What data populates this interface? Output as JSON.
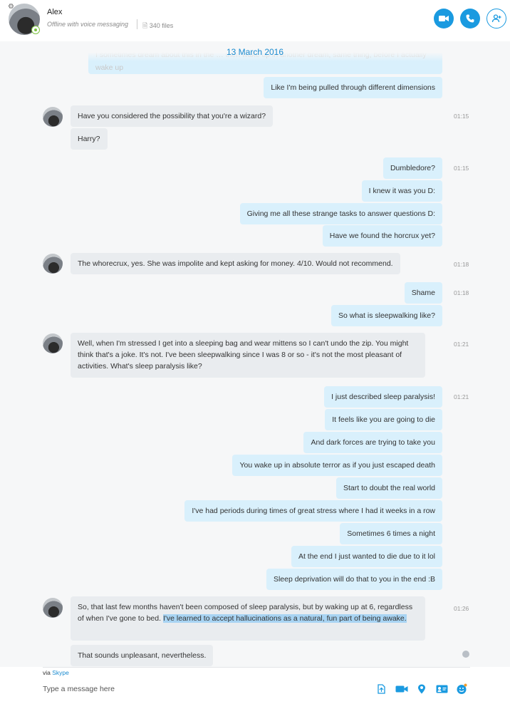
{
  "header": {
    "contact_name": "Alex",
    "status_text": "Offline with voice messaging",
    "files_text": "340 files",
    "accent_color": "#1a9ae0"
  },
  "chat": {
    "date_separator": "13 March 2016",
    "ghost_text": "I sometimes dream about this in the … then wake up in another dream, same thing, before I actually wake up",
    "groups": [
      {
        "dir": "out",
        "time": "",
        "messages": [
          "Like I'm being pulled through different dimensions"
        ]
      },
      {
        "dir": "in",
        "time": "01:15",
        "messages": [
          "Have you considered the possibility that you're a wizard?",
          "Harry?"
        ]
      },
      {
        "dir": "out",
        "time": "01:15",
        "messages": [
          "Dumbledore?",
          "I knew it was you D:",
          "Giving me all these strange tasks to answer questions D:",
          "Have we found the horcrux yet?"
        ]
      },
      {
        "dir": "in",
        "time": "01:18",
        "messages": [
          "The whorecrux, yes. She was impolite and kept asking for money. 4/10. Would not recommend."
        ]
      },
      {
        "dir": "out",
        "time": "01:18",
        "messages": [
          "Shame",
          "So what is sleepwalking like?"
        ]
      },
      {
        "dir": "in",
        "time": "01:21",
        "messages": [
          "Well, when I'm stressed I get into a sleeping bag and wear mittens so I can't undo the zip. You might think that's a joke. It's not. I've been sleepwalking since I was 8 or so - it's not the most pleasant of activities.  What's sleep paralysis like?"
        ]
      },
      {
        "dir": "out",
        "time": "01:21",
        "messages": [
          "I just described sleep paralysis!",
          "It feels like you are going to die",
          "And dark forces are trying to take you",
          "You wake up in absolute terror as if you just escaped death",
          "Start to doubt the real world",
          "I've had periods during times of great stress where I had it weeks in a row",
          "Sometimes 6 times a night",
          "At the end I just wanted to die due to it lol",
          "Sleep deprivation will do that to you in the end :B"
        ]
      },
      {
        "dir": "in",
        "time": "01:26",
        "messages": [
          "So, that last few months haven't been composed of sleep paralysis, but by waking up at 6, regardless of when I've gone to bed.",
          "That sounds unpleasant, nevertheless."
        ]
      }
    ],
    "highlighted_text": "I've learned to accept hallucinations as a natural, fun part of being awake."
  },
  "composer": {
    "via_label": "via",
    "via_link": "Skype",
    "placeholder": "Type a message here"
  },
  "icons": {
    "settings": "gear-icon",
    "video": "video-call-icon",
    "call": "phone-icon",
    "add": "add-person-icon",
    "files": "file-icon",
    "send_file": "send-file-icon",
    "video_message": "video-message-icon",
    "location": "location-icon",
    "contact": "contact-card-icon",
    "emoticon": "emoticon-icon"
  }
}
